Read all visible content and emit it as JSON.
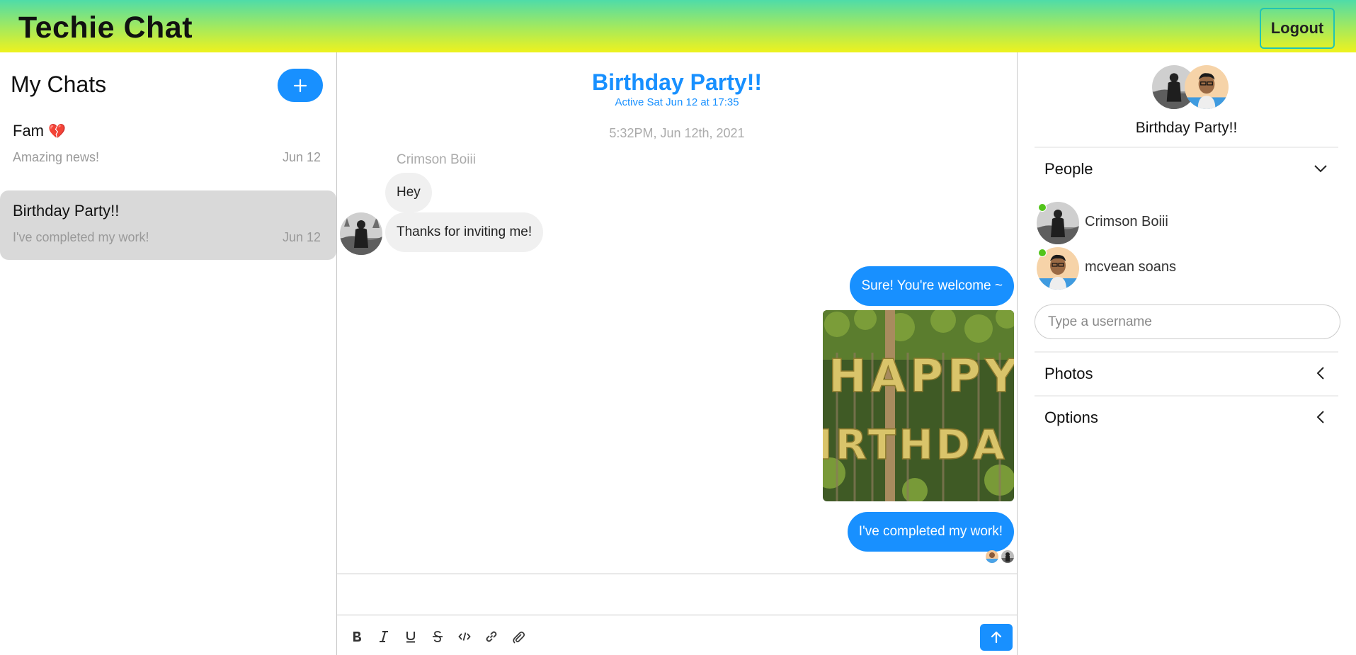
{
  "header": {
    "app_title": "Techie Chat",
    "logout_label": "Logout"
  },
  "sidebar": {
    "title": "My Chats",
    "new_chat_icon": "plus-icon",
    "chats": [
      {
        "name": "Fam",
        "icon": "broken-heart-icon",
        "preview": "Amazing news!",
        "date": "Jun 12",
        "selected": false
      },
      {
        "name": "Birthday Party!!",
        "preview": "I've completed my work!",
        "date": "Jun 12",
        "selected": true
      }
    ]
  },
  "chat": {
    "title": "Birthday Party!!",
    "subtitle": "Active Sat Jun 12 at 17:35",
    "timestamp": "5:32PM, Jun 12th, 2021",
    "sender_name": "Crimson Boiii",
    "incoming": [
      "Hey",
      "Thanks for inviting me!"
    ],
    "outgoing": [
      "Sure! You're welcome ~",
      "I've completed my work!"
    ],
    "photo_text": "HAPPY BIRTHDAY",
    "composer_placeholder": ""
  },
  "details": {
    "title": "Birthday Party!!",
    "people_label": "People",
    "people": [
      {
        "name": "Crimson Boiii",
        "online": true
      },
      {
        "name": "mcvean soans",
        "online": true
      }
    ],
    "username_placeholder": "Type a username",
    "photos_label": "Photos",
    "options_label": "Options"
  },
  "colors": {
    "accent": "#1890ff",
    "online": "#52c41a",
    "selected_chat": "#d9d9d9"
  }
}
